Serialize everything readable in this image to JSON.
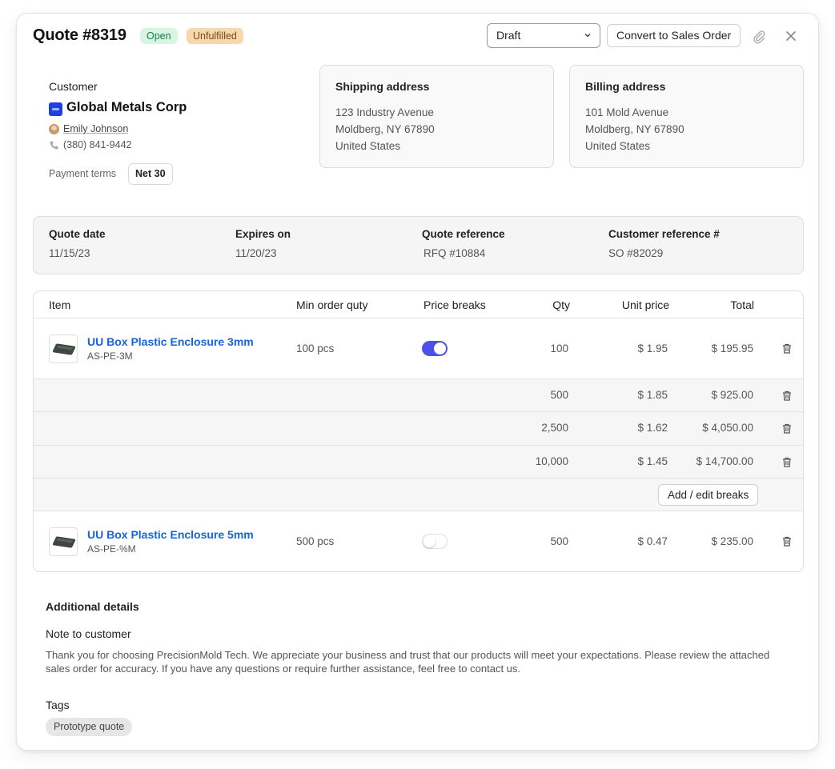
{
  "header": {
    "title": "Quote #8319",
    "status_badge": "Open",
    "fulfillment_badge": "Unfulfilled",
    "status_select": "Draft",
    "convert_button": "Convert to Sales Order"
  },
  "customer": {
    "label": "Customer",
    "name": "Global Metals Corp",
    "contact": "Emily Johnson",
    "phone": "(380) 841-9442",
    "payment_terms_label": "Payment terms",
    "payment_terms": "Net 30"
  },
  "shipping": {
    "heading": "Shipping address",
    "line1": "123 Industry Avenue",
    "line2": "Moldberg, NY 67890",
    "line3": "United States"
  },
  "billing": {
    "heading": "Billing address",
    "line1": "101 Mold Avenue",
    "line2": "Moldberg, NY 67890",
    "line3": "United States"
  },
  "meta": {
    "quote_date_label": "Quote date",
    "quote_date": "11/15/23",
    "expires_label": "Expires on",
    "expires": "11/20/23",
    "quote_ref_label": "Quote reference",
    "quote_ref": "RFQ #10884",
    "customer_ref_label": "Customer reference #",
    "customer_ref": "SO #82029"
  },
  "table": {
    "headers": {
      "item": "Item",
      "min_order": "Min order quty",
      "price_breaks": "Price breaks",
      "qty": "Qty",
      "unit_price": "Unit price",
      "total": "Total"
    },
    "items": [
      {
        "name": "UU Box Plastic Enclosure 3mm",
        "sku": "AS-PE-3M",
        "min_order": "100 pcs",
        "price_breaks_enabled": true,
        "qty": "100",
        "unit_price": "$ 1.95",
        "total": "$ 195.95",
        "breaks": [
          {
            "qty": "500",
            "unit_price": "$ 1.85",
            "total": "$ 925.00"
          },
          {
            "qty": "2,500",
            "unit_price": "$ 1.62",
            "total": "$ 4,050.00"
          },
          {
            "qty": "10,000",
            "unit_price": "$ 1.45",
            "total": "$ 14,700.00"
          }
        ],
        "add_breaks_button": "Add / edit breaks"
      },
      {
        "name": "UU Box Plastic Enclosure 5mm",
        "sku": "AS-PE-%M",
        "min_order": "500 pcs",
        "price_breaks_enabled": false,
        "qty": "500",
        "unit_price": "$ 0.47",
        "total": "$ 235.00"
      }
    ]
  },
  "details": {
    "title": "Additional details",
    "note_label": "Note to customer",
    "note": "Thank you for choosing PrecisionMold Tech. We appreciate your business and trust that our products will meet your expectations. Please review the attached sales order for accuracy. If you have any questions or require further assistance, feel free to contact us.",
    "tags_label": "Tags",
    "tags": [
      "Prototype quote"
    ]
  },
  "colors": {
    "accent": "#4b52e8",
    "link": "#1565d8",
    "open_badge_bg": "#d6f5e2",
    "unfulfilled_badge_bg": "#f7d8ae",
    "brand_logo": "#1f3fe0"
  },
  "icons": [
    "chevron-down-icon",
    "paperclip-icon",
    "close-icon",
    "phone-icon",
    "trash-icon"
  ]
}
